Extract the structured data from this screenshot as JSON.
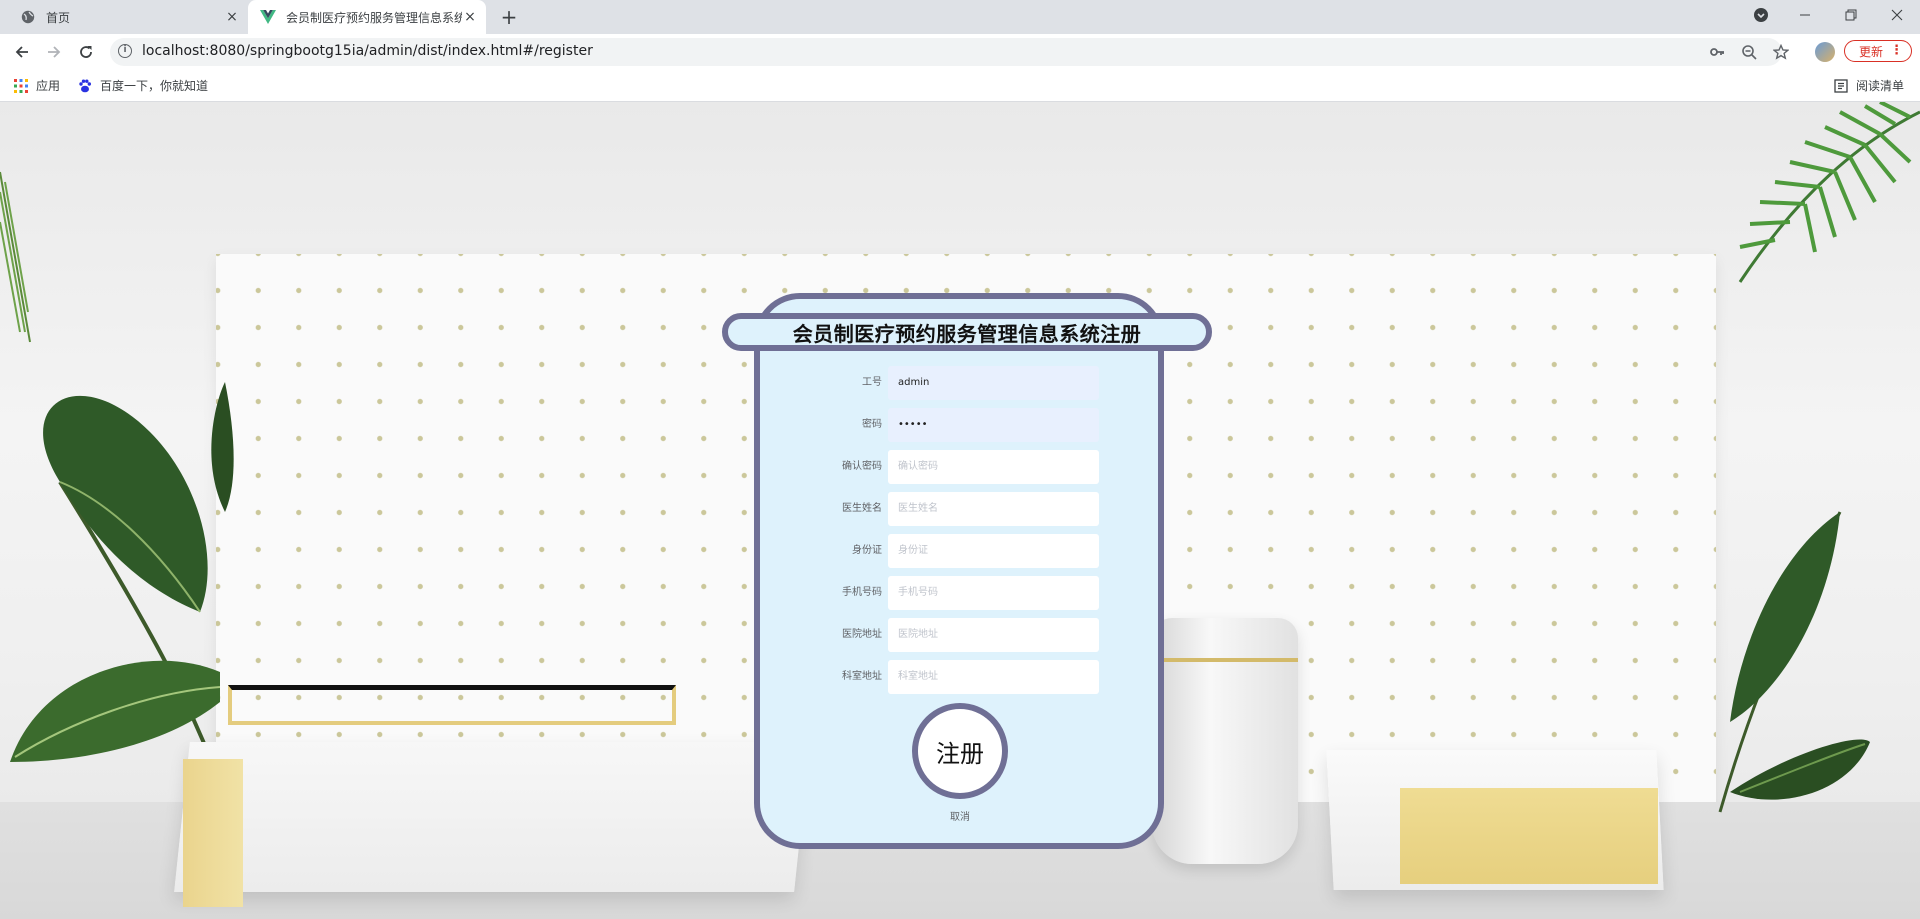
{
  "browser": {
    "tabs": [
      {
        "title": "首页",
        "active": false
      },
      {
        "title": "会员制医疗预约服务管理信息系统",
        "active": true
      }
    ],
    "url": "localhost:8080/springbootg15ia/admin/dist/index.html#/register",
    "update_label": "更新",
    "update_menu": "⋮",
    "new_tab": "+",
    "bookmarks": [
      {
        "label": "应用",
        "icon": "apps-grid-icon"
      },
      {
        "label": "百度一下，你就知道",
        "icon": "baidu-paw-icon"
      }
    ],
    "reading_list": "阅读清单",
    "tab_close": "×"
  },
  "form": {
    "title": "会员制医疗预约服务管理信息系统注册",
    "fields": [
      {
        "label": "工号",
        "value": "admin",
        "placeholder": "工号"
      },
      {
        "label": "密码",
        "value": "•••••",
        "placeholder": "密码"
      },
      {
        "label": "确认密码",
        "value": "",
        "placeholder": "确认密码"
      },
      {
        "label": "医生姓名",
        "value": "",
        "placeholder": "医生姓名"
      },
      {
        "label": "身份证",
        "value": "",
        "placeholder": "身份证"
      },
      {
        "label": "手机号码",
        "value": "",
        "placeholder": "手机号码"
      },
      {
        "label": "医院地址",
        "value": "",
        "placeholder": "医院地址"
      },
      {
        "label": "科室地址",
        "value": "",
        "placeholder": "科室地址"
      }
    ],
    "register_label": "注册",
    "cancel_label": "取消"
  },
  "colors": {
    "card_bg": "#def2fc",
    "card_border": "#6f6f95",
    "update_red": "#d93025",
    "autofill_bg": "#e8f0fe"
  }
}
